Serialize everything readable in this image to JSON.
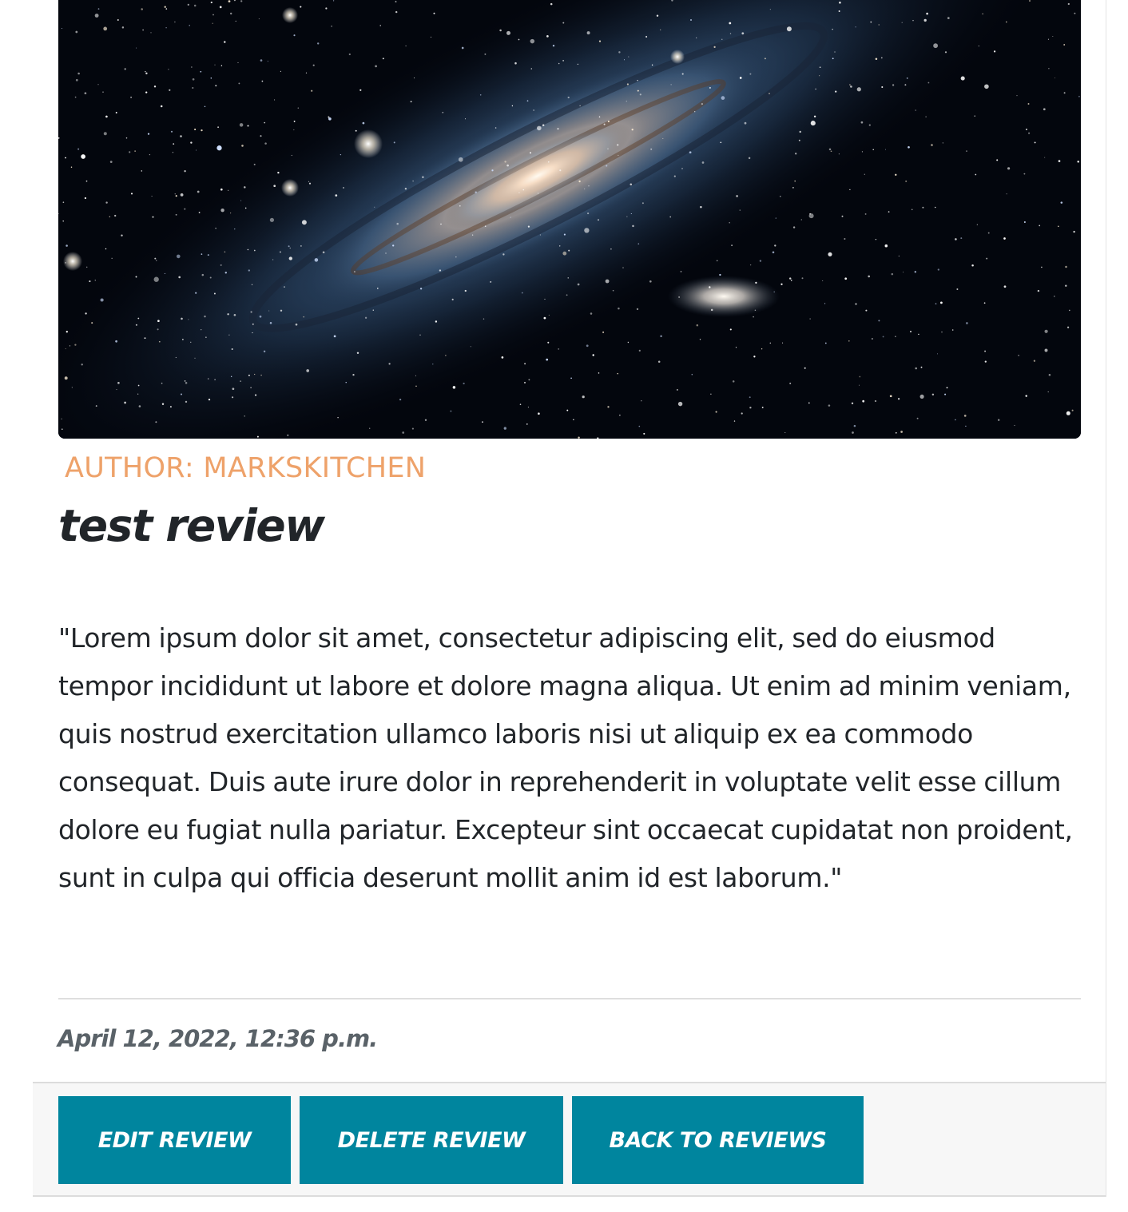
{
  "review": {
    "image_alt": "galaxy-image",
    "author_label": "AUTHOR: MARKSKITCHEN",
    "title": "test review",
    "body": "\"Lorem ipsum dolor sit amet, consectetur adipiscing elit, sed do eiusmod tempor incididunt ut labore et dolore magna aliqua. Ut enim ad minim veniam, quis nostrud exercitation ullamco laboris nisi ut aliquip ex ea commodo consequat. Duis aute irure dolor in reprehenderit in voluptate velit esse cillum dolore eu fugiat nulla pariatur. Excepteur sint occaecat cupidatat non proident, sunt in culpa qui officia deserunt mollit anim id est laborum.\"",
    "date": "April 12, 2022, 12:36 p.m."
  },
  "actions": {
    "edit_label": "EDIT REVIEW",
    "delete_label": "DELETE REVIEW",
    "back_label": "BACK TO REVIEWS"
  },
  "colors": {
    "author": "#eea26a",
    "button_bg": "#00859e",
    "button_text": "#ffffff",
    "title_text": "#212529",
    "date_text": "#5a6268"
  }
}
